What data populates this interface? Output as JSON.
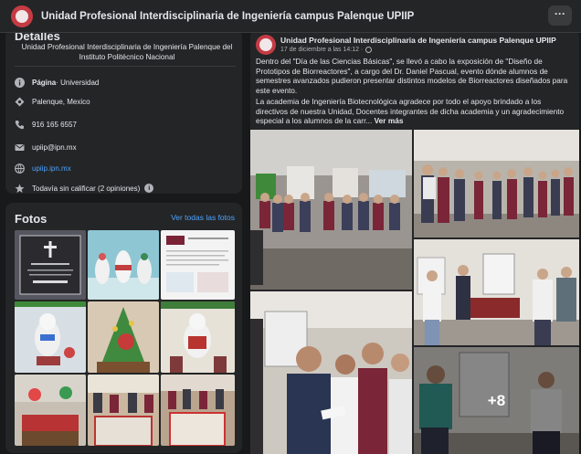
{
  "header": {
    "title": "Unidad Profesional Interdisciplinaria de Ingeniería campus Palenque UPIIP",
    "more_label": "···"
  },
  "details": {
    "heading": "Detalles",
    "description": "Unidad Profesional Interdisciplinaria de Ingeniería Palenque del Instituto Politécnico Nacional",
    "page_label": "Página",
    "page_category": " · Universidad",
    "location": "Palenque, Mexico",
    "phone": "916 165 6557",
    "email": "upiip@ipn.mx",
    "website": "upiip.ipn.mx",
    "rating": "Todavía sin calificar (2 opiniones)",
    "rating_help": "i",
    "icons": [
      "info-icon",
      "location-icon",
      "phone-icon",
      "email-icon",
      "website-icon",
      "star-icon"
    ]
  },
  "photos": {
    "heading": "Fotos",
    "see_all": "Ver todas las fotos"
  },
  "post": {
    "author": "Unidad Profesional Interdisciplinaria de Ingeniería campus Palenque UPIIP",
    "date": "17 de diciembre a las 14:12 ·",
    "paragraph1": "Dentro del \"Día de las Ciencias Básicas\", se llevó a cabo la exposición de \"Diseño de Prototipos de Biorreactores\", a cargo del Dr. Daniel Pascual, evento dónde alumnos de semestres avanzados pudieron presentar distintos modelos de Biorreactores diseñados para este evento.",
    "paragraph2": "La academia de Ingeniería Biotecnológica agradece por todo el apoyo brindado a los directivos de nuestra Unidad, Docentes integrantes de dicha academia y un agradecimiento especial a los alumnos de la carr...",
    "more": "Ver más",
    "extra_photos": "+8"
  },
  "colors": {
    "background": "#18191a",
    "card": "#242526",
    "link": "#4da3ff",
    "text": "#e4e6eb",
    "muted": "#b0b3b8"
  }
}
